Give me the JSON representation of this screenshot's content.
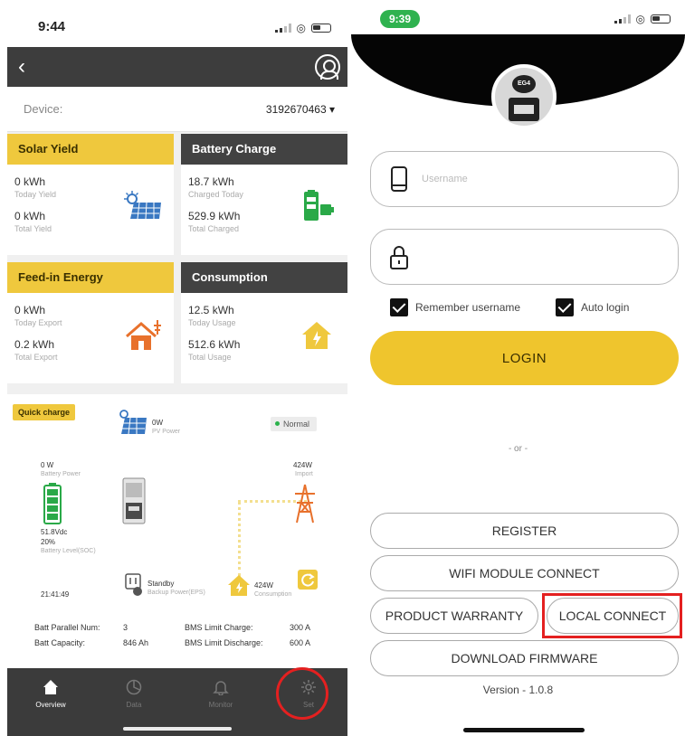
{
  "left": {
    "status": {
      "time": "9:44"
    },
    "device": {
      "label": "Device:",
      "value": "3192670463 ▾"
    },
    "cards": {
      "solar": {
        "title": "Solar Yield",
        "v1": "0 kWh",
        "l1": "Today Yield",
        "v2": "0 kWh",
        "l2": "Total Yield"
      },
      "battery": {
        "title": "Battery Charge",
        "v1": "18.7 kWh",
        "l1": "Charged Today",
        "v2": "529.9 kWh",
        "l2": "Total Charged"
      },
      "feedin": {
        "title": "Feed-in Energy",
        "v1": "0 kWh",
        "l1": "Today Export",
        "v2": "0.2 kWh",
        "l2": "Total Export"
      },
      "consumption": {
        "title": "Consumption",
        "v1": "12.5 kWh",
        "l1": "Today Usage",
        "v2": "512.6 kWh",
        "l2": "Total Usage"
      }
    },
    "flow": {
      "quick_charge": "Quick charge",
      "status": "Normal",
      "pv_value": "0W",
      "pv_label": "PV Power",
      "battery_power_value": "0 W",
      "battery_power_label": "Battery Power",
      "battery_voltage": "51.8Vdc",
      "battery_soc": "20%",
      "battery_level_label": "Battery Level(SOC)",
      "import_value": "424W",
      "import_label": "Import",
      "standby": "Standby",
      "backup_label": "Backup Power(EPS)",
      "consumption_value": "424W",
      "consumption_label": "Consumption",
      "clock": "21:41:49",
      "batt_parallel_label": "Batt Parallel Num:",
      "batt_parallel_value": "3",
      "batt_capacity_label": "Batt Capacity:",
      "batt_capacity_value": "846 Ah",
      "bms_charge_label": "BMS Limit Charge:",
      "bms_charge_value": "300 A",
      "bms_discharge_label": "BMS Limit Discharge:",
      "bms_discharge_value": "600 A"
    },
    "tabs": [
      {
        "label": "Overview",
        "icon": "home-icon"
      },
      {
        "label": "Data",
        "icon": "pie-chart-icon"
      },
      {
        "label": "Monitor",
        "icon": "bell-icon"
      },
      {
        "label": "Set",
        "icon": "gear-icon"
      }
    ],
    "colors": {
      "accent": "#efc83d",
      "header_dark": "#3d3d3d",
      "highlight_red": "#e42020"
    }
  },
  "right": {
    "status": {
      "time": "9:39"
    },
    "logo_text": "EG4",
    "username": {
      "placeholder": "Username",
      "value": ""
    },
    "password": {
      "placeholder": "",
      "value": ""
    },
    "remember_label": "Remember username",
    "autologin_label": "Auto login",
    "login_label": "LOGIN",
    "or_label": "- or -",
    "register_label": "REGISTER",
    "wifi_label": "WIFI MODULE CONNECT",
    "warranty_label": "PRODUCT WARRANTY",
    "local_label": "LOCAL CONNECT",
    "firmware_label": "DOWNLOAD FIRMWARE",
    "version": "Version - 1.0.8",
    "colors": {
      "login_button": "#efc52d",
      "status_pill": "#2fb24f"
    }
  }
}
